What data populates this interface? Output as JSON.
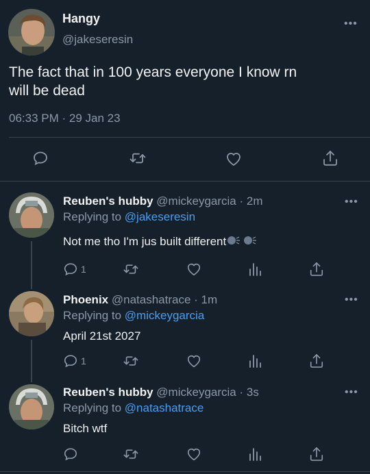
{
  "main_tweet": {
    "display_name": "Hangy",
    "handle": "@jakeseresin",
    "text_line1": "The fact that in 100 years everyone I know rn",
    "text_line2": "will be dead",
    "timestamp": "06:33 PM · 29 Jan 23",
    "icons": [
      "reply-icon",
      "retweet-icon",
      "like-icon",
      "share-icon"
    ]
  },
  "replies": [
    {
      "display_name": "Reuben's hubby",
      "handle": "@mickeygarcia",
      "time": "· 2m",
      "replying_prefix": "Replying to",
      "replying_handle": "@jakeseresin",
      "text": "Not me tho I'm jus built different",
      "reply_count": "1"
    },
    {
      "display_name": "Phoenix",
      "handle": "@natashatrace",
      "time": "· 1m",
      "replying_prefix": "Replying to",
      "replying_handle": "@mickeygarcia",
      "text": "April 21st 2027",
      "reply_count": "1"
    },
    {
      "display_name": "Reuben's hubby",
      "handle": "@mickeygarcia",
      "time": "· 3s",
      "replying_prefix": "Replying to",
      "replying_handle": "@natashatrace",
      "text": "Bitch wtf",
      "reply_count": ""
    }
  ],
  "more_glyph": "•••",
  "colors": {
    "background": "#15202b",
    "link": "#4a9ef0",
    "muted": "#8b98a5",
    "divider": "#38444d"
  }
}
